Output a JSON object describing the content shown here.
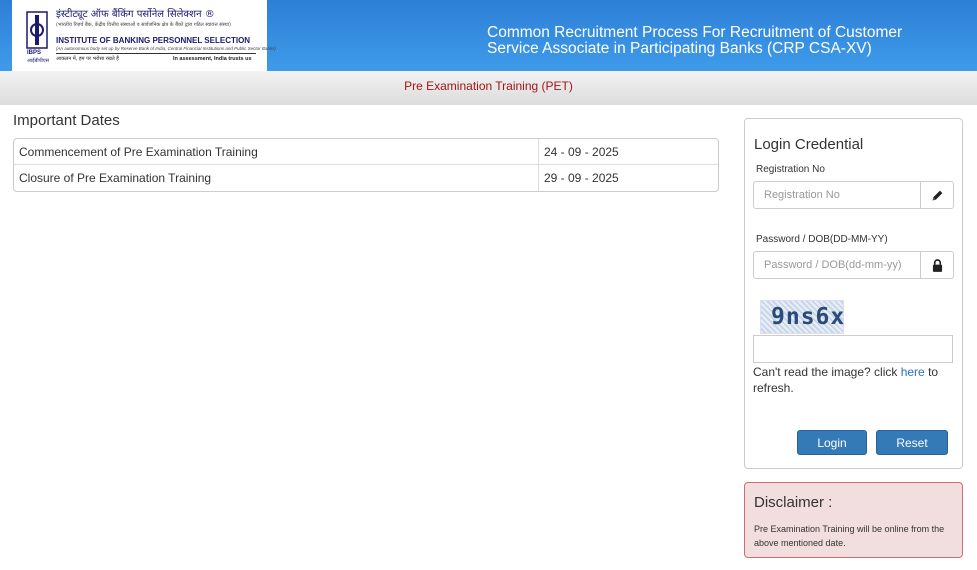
{
  "header": {
    "logo": {
      "hindi_title": "इंस्टीट्यूट ऑफ बैंकिंग पर्सोनेल सिलेक्शन ®",
      "hindi_subtitle": "(भारतीय रिज़र्व बैंक, केंद्रीय वित्तीय संस्थाओं व सार्वजनिक क्षेत्र के बैंकों द्वारा गठित स्वायत्त संस्था)",
      "english_title": "INSTITUTE OF BANKING PERSONNEL SELECTION",
      "english_subtitle": "(An autonomous body set up by Reserve Bank of India, Central Financial Institutions and Public Sector Banks)",
      "tagline_hindi": "आकलन में, हम पर भरोसा रखते हैं",
      "tagline_english": "In assessment, India trusts us",
      "ibps": "IBPS",
      "ibps_hindi": "आईबीपीएस"
    },
    "title": "Common Recruitment Process For Recruitment of Customer Service Associate in Participating Banks (CRP CSA-XV)"
  },
  "subbar": {
    "label": "Pre Examination Training (PET)"
  },
  "important_dates": {
    "title": "Important Dates",
    "rows": [
      {
        "event": "Commencement of Pre Examination Training",
        "date": "24 - 09 - 2025"
      },
      {
        "event": "Closure of Pre Examination Training",
        "date": "29 - 09 - 2025"
      }
    ]
  },
  "login": {
    "title": "Login Credential",
    "registration_label": "Registration No",
    "registration_placeholder": "Registration No",
    "password_label": "Password / DOB(DD-MM-YY)",
    "password_placeholder": "Password / DOB(dd-mm-yy)",
    "captcha_text": "9ns6x",
    "refresh_prefix": "Can't read the image? click ",
    "refresh_link": "here",
    "refresh_suffix": " to refresh.",
    "login_button": "Login",
    "reset_button": "Reset"
  },
  "disclaimer": {
    "title": "Disclaimer :",
    "text": "Pre Examination Training will be online from the above mentioned date."
  },
  "colors": {
    "header_blue": "#3a93e4",
    "subbar_text": "#a31515",
    "button_blue": "#337ab7",
    "disclaimer_bg": "#f2dede",
    "disclaimer_border": "#d46b6b",
    "link": "#2a6ebb"
  },
  "icons": {
    "registration_addon": "pencil-icon",
    "password_addon": "lock-icon"
  }
}
